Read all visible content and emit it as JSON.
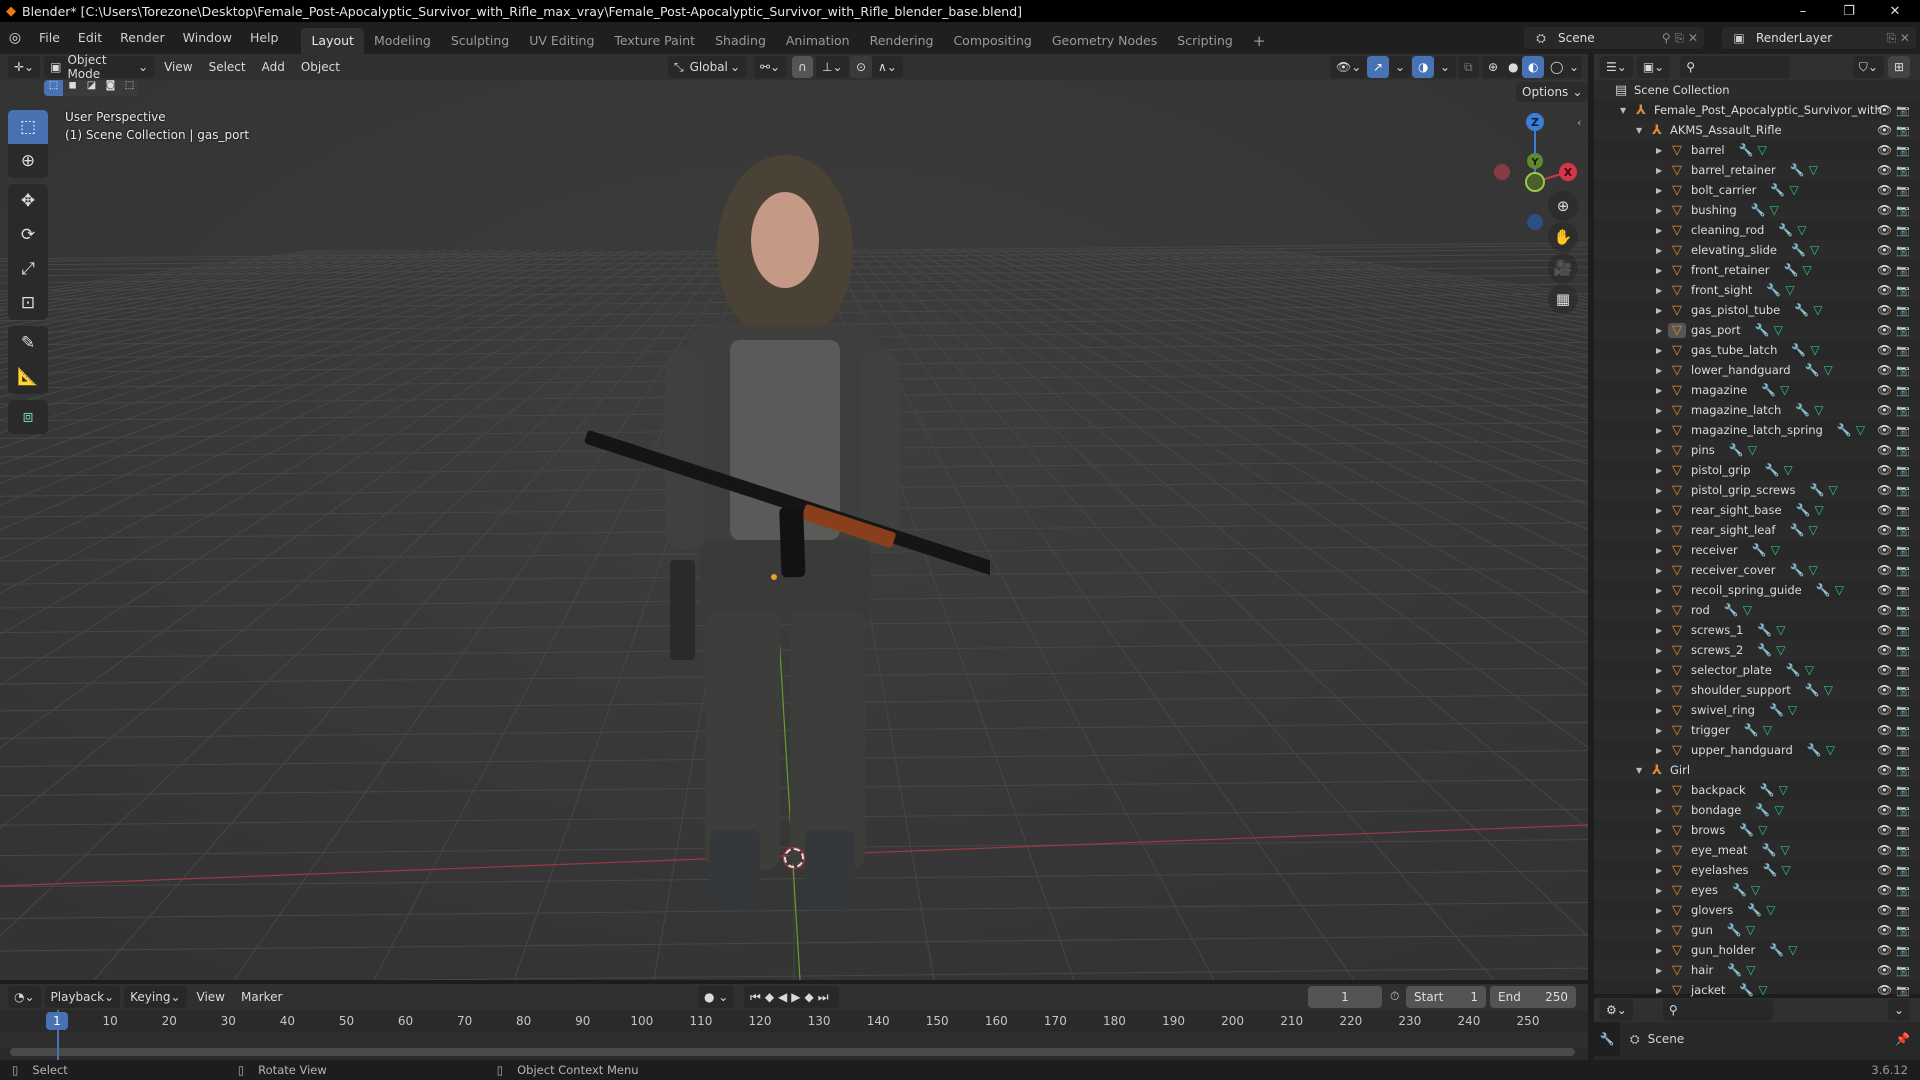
{
  "window": {
    "title": "Blender* [C:\\Users\\Torezone\\Desktop\\Female_Post-Apocalyptic_Survivor_with_Rifle_max_vray\\Female_Post-Apocalyptic_Survivor_with_Rifle_blender_base.blend]",
    "minimize": "–",
    "restore": "❐",
    "close": "✕"
  },
  "menu": {
    "items": [
      "File",
      "Edit",
      "Render",
      "Window",
      "Help"
    ],
    "workspaces": [
      "Layout",
      "Modeling",
      "Sculpting",
      "UV Editing",
      "Texture Paint",
      "Shading",
      "Animation",
      "Rendering",
      "Compositing",
      "Geometry Nodes",
      "Scripting"
    ],
    "active_workspace": "Layout",
    "add_workspace": "+",
    "scene": "Scene",
    "view_layer": "RenderLayer"
  },
  "viewport_header": {
    "mode": "Object Mode",
    "menus": [
      "View",
      "Select",
      "Add",
      "Object"
    ],
    "transform_orientation": "Global",
    "options": "Options"
  },
  "viewport": {
    "perspective_label": "User Perspective",
    "collection_label": "(1) Scene Collection | gas_port",
    "gizmo": {
      "x": "X",
      "y": "Y",
      "z": "Z"
    },
    "colors": {
      "x_axis": "#c93a4a",
      "y_axis": "#7aa83a",
      "z_axis": "#3b7fd9",
      "active": "#4772b3"
    }
  },
  "toolbar": {
    "tools": [
      "select-box",
      "cursor",
      "move",
      "rotate",
      "scale",
      "transform",
      "annotate",
      "measure",
      "add-cube"
    ]
  },
  "outliner": {
    "root": "Scene Collection",
    "top_object": "Female_Post_Apocalyptic_Survivor_with",
    "groups": [
      {
        "name": "AKMS_Assault_Rifle",
        "children": [
          "barrel",
          "barrel_retainer",
          "bolt_carrier",
          "bushing",
          "cleaning_rod",
          "elevating_slide",
          "front_retainer",
          "front_sight",
          "gas_pistol_tube",
          "gas_port",
          "gas_tube_latch",
          "lower_handguard",
          "magazine",
          "magazine_latch",
          "magazine_latch_spring",
          "pins",
          "pistol_grip",
          "pistol_grip_screws",
          "rear_sight_base",
          "rear_sight_leaf",
          "receiver",
          "receiver_cover",
          "recoil_spring_guide",
          "rod",
          "screws_1",
          "screws_2",
          "selector_plate",
          "shoulder_support",
          "swivel_ring",
          "trigger",
          "upper_handguard"
        ]
      },
      {
        "name": "Girl",
        "children": [
          "backpack",
          "bondage",
          "brows",
          "eye_meat",
          "eyelashes",
          "eyes",
          "glovers",
          "gun",
          "gun_holder",
          "hair",
          "jacket"
        ]
      }
    ],
    "active_item": "gas_port"
  },
  "properties": {
    "context": "Scene"
  },
  "timeline": {
    "menus": [
      "Playback",
      "Keying",
      "View",
      "Marker"
    ],
    "current_frame": "1",
    "start_label": "Start",
    "start": "1",
    "end_label": "End",
    "end": "250",
    "ticks": [
      "1",
      "10",
      "20",
      "30",
      "40",
      "50",
      "60",
      "70",
      "80",
      "90",
      "100",
      "110",
      "120",
      "130",
      "140",
      "150",
      "160",
      "170",
      "180",
      "190",
      "200",
      "210",
      "220",
      "230",
      "240",
      "250"
    ]
  },
  "statusbar": {
    "select": "Select",
    "rotate": "Rotate View",
    "context_menu": "Object Context Menu",
    "version": "3.6.12"
  }
}
